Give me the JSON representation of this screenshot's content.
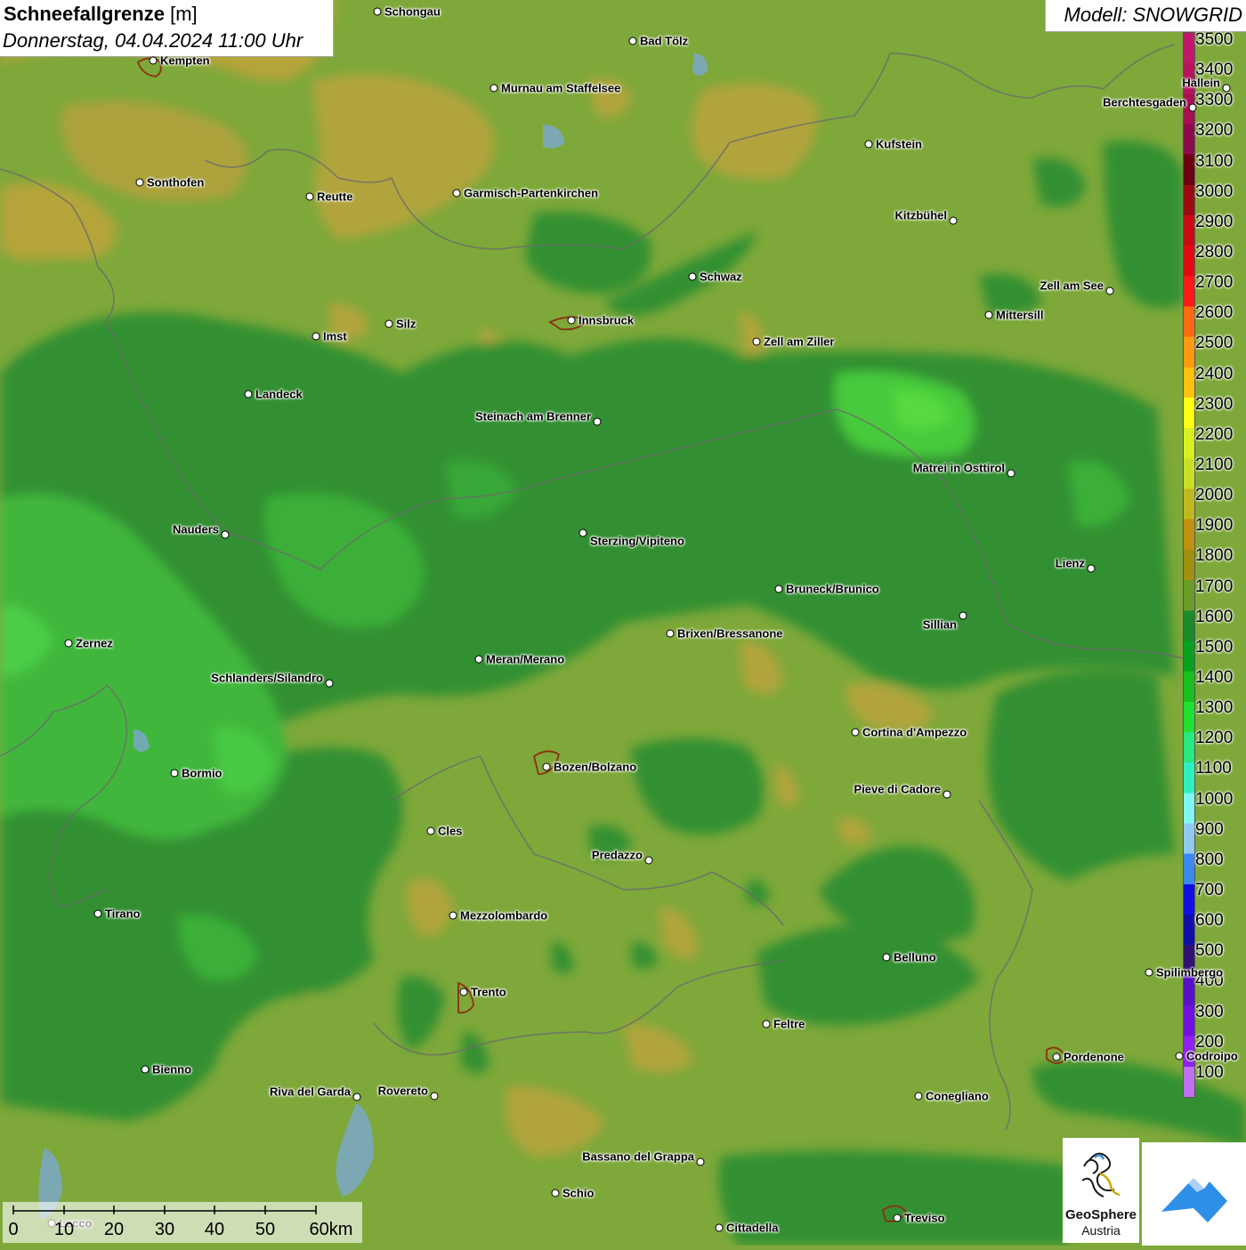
{
  "header": {
    "title_bold": "Schneefallgrenze",
    "title_unit": "[m]",
    "datetime": "Donnerstag, 04.04.2024 11:00 Uhr",
    "model": "Modell: SNOWGRID"
  },
  "legend": {
    "levels": [
      "3500",
      "3400",
      "3300",
      "3200",
      "3100",
      "3000",
      "2900",
      "2800",
      "2700",
      "2600",
      "2500",
      "2400",
      "2300",
      "2200",
      "2100",
      "2000",
      "1900",
      "1800",
      "1700",
      "1600",
      "1500",
      "1400",
      "1300",
      "1200",
      "1100",
      "1000",
      "900",
      "800",
      "700",
      "600",
      "500",
      "400",
      "300",
      "200",
      "100"
    ],
    "colors": [
      "#c2186b",
      "#b5145f",
      "#a51054",
      "#8c0a4e",
      "#6b0010",
      "#9a0a10",
      "#c80a12",
      "#e00a12",
      "#ff1a1a",
      "#ff6a10",
      "#ff9a10",
      "#ffc010",
      "#ffff10",
      "#d8f020",
      "#c8e028",
      "#c0b820",
      "#c09010",
      "#a09010",
      "#6a9c2a",
      "#1a8a2a",
      "#0aa020",
      "#18c020",
      "#20e030",
      "#28e880",
      "#30f0c0",
      "#80f8f0",
      "#90c8f0",
      "#3a88f0",
      "#1010e0",
      "#1010a8",
      "#301070",
      "#5810c8",
      "#7010e0",
      "#9020f0",
      "#c070f0"
    ]
  },
  "cities": [
    {
      "id": "schongau",
      "name": "Schongau"
    },
    {
      "id": "bad-toelz",
      "name": "Bad Tölz"
    },
    {
      "id": "kempten",
      "name": "Kempten"
    },
    {
      "id": "murnau",
      "name": "Murnau am Staffelsee"
    },
    {
      "id": "hallein",
      "name": "Hallein"
    },
    {
      "id": "berchtesgaden",
      "name": "Berchtesgaden"
    },
    {
      "id": "kufstein",
      "name": "Kufstein"
    },
    {
      "id": "sonthofen",
      "name": "Sonthofen"
    },
    {
      "id": "reutte",
      "name": "Reutte"
    },
    {
      "id": "garmisch",
      "name": "Garmisch-Partenkirchen"
    },
    {
      "id": "kitzbuehel",
      "name": "Kitzbühel"
    },
    {
      "id": "schwaz",
      "name": "Schwaz"
    },
    {
      "id": "zell-am-see",
      "name": "Zell am See"
    },
    {
      "id": "mittersill",
      "name": "Mittersill"
    },
    {
      "id": "innsbruck",
      "name": "Innsbruck"
    },
    {
      "id": "silz",
      "name": "Silz"
    },
    {
      "id": "imst",
      "name": "Imst"
    },
    {
      "id": "zell-am-ziller",
      "name": "Zell am Ziller"
    },
    {
      "id": "landeck",
      "name": "Landeck"
    },
    {
      "id": "steinach",
      "name": "Steinach am Brenner"
    },
    {
      "id": "matrei",
      "name": "Matrei in Osttirol"
    },
    {
      "id": "nauders",
      "name": "Nauders"
    },
    {
      "id": "sterzing",
      "name": "Sterzing/Vipiteno"
    },
    {
      "id": "lienz",
      "name": "Lienz"
    },
    {
      "id": "bruneck",
      "name": "Bruneck/Brunico"
    },
    {
      "id": "sillian",
      "name": "Sillian"
    },
    {
      "id": "brixen",
      "name": "Brixen/Bressanone"
    },
    {
      "id": "zernez",
      "name": "Zernez"
    },
    {
      "id": "meran",
      "name": "Meran/Merano"
    },
    {
      "id": "schlanders",
      "name": "Schlanders/Silandro"
    },
    {
      "id": "cortina",
      "name": "Cortina d'Ampezzo"
    },
    {
      "id": "bozen",
      "name": "Bozen/Bolzano"
    },
    {
      "id": "bormio",
      "name": "Bormio"
    },
    {
      "id": "pieve",
      "name": "Pieve di Cadore"
    },
    {
      "id": "cles",
      "name": "Cles"
    },
    {
      "id": "predazzo",
      "name": "Predazzo"
    },
    {
      "id": "tirano",
      "name": "Tirano"
    },
    {
      "id": "mezzolombardo",
      "name": "Mezzolombardo"
    },
    {
      "id": "belluno",
      "name": "Belluno"
    },
    {
      "id": "spilimbergo",
      "name": "Spilimbergo"
    },
    {
      "id": "trento",
      "name": "Trento"
    },
    {
      "id": "feltre",
      "name": "Feltre"
    },
    {
      "id": "pordenone",
      "name": "Pordenone"
    },
    {
      "id": "codroipo",
      "name": "Codroipo"
    },
    {
      "id": "bienno",
      "name": "Bienno"
    },
    {
      "id": "riva",
      "name": "Riva del Garda"
    },
    {
      "id": "rovereto",
      "name": "Rovereto"
    },
    {
      "id": "conegliano",
      "name": "Conegliano"
    },
    {
      "id": "bassano",
      "name": "Bassano del Grappa"
    },
    {
      "id": "schio",
      "name": "Schio"
    },
    {
      "id": "treviso",
      "name": "Treviso"
    },
    {
      "id": "cittadella",
      "name": "Cittadella"
    },
    {
      "id": "lecco",
      "name": "Lecco"
    }
  ],
  "scalebar": {
    "labels": [
      "0",
      "10",
      "20",
      "30",
      "40",
      "50",
      "60km"
    ]
  },
  "logos": {
    "geosphere_name": "GeoSphere",
    "geosphere_sub": "Austria"
  }
}
